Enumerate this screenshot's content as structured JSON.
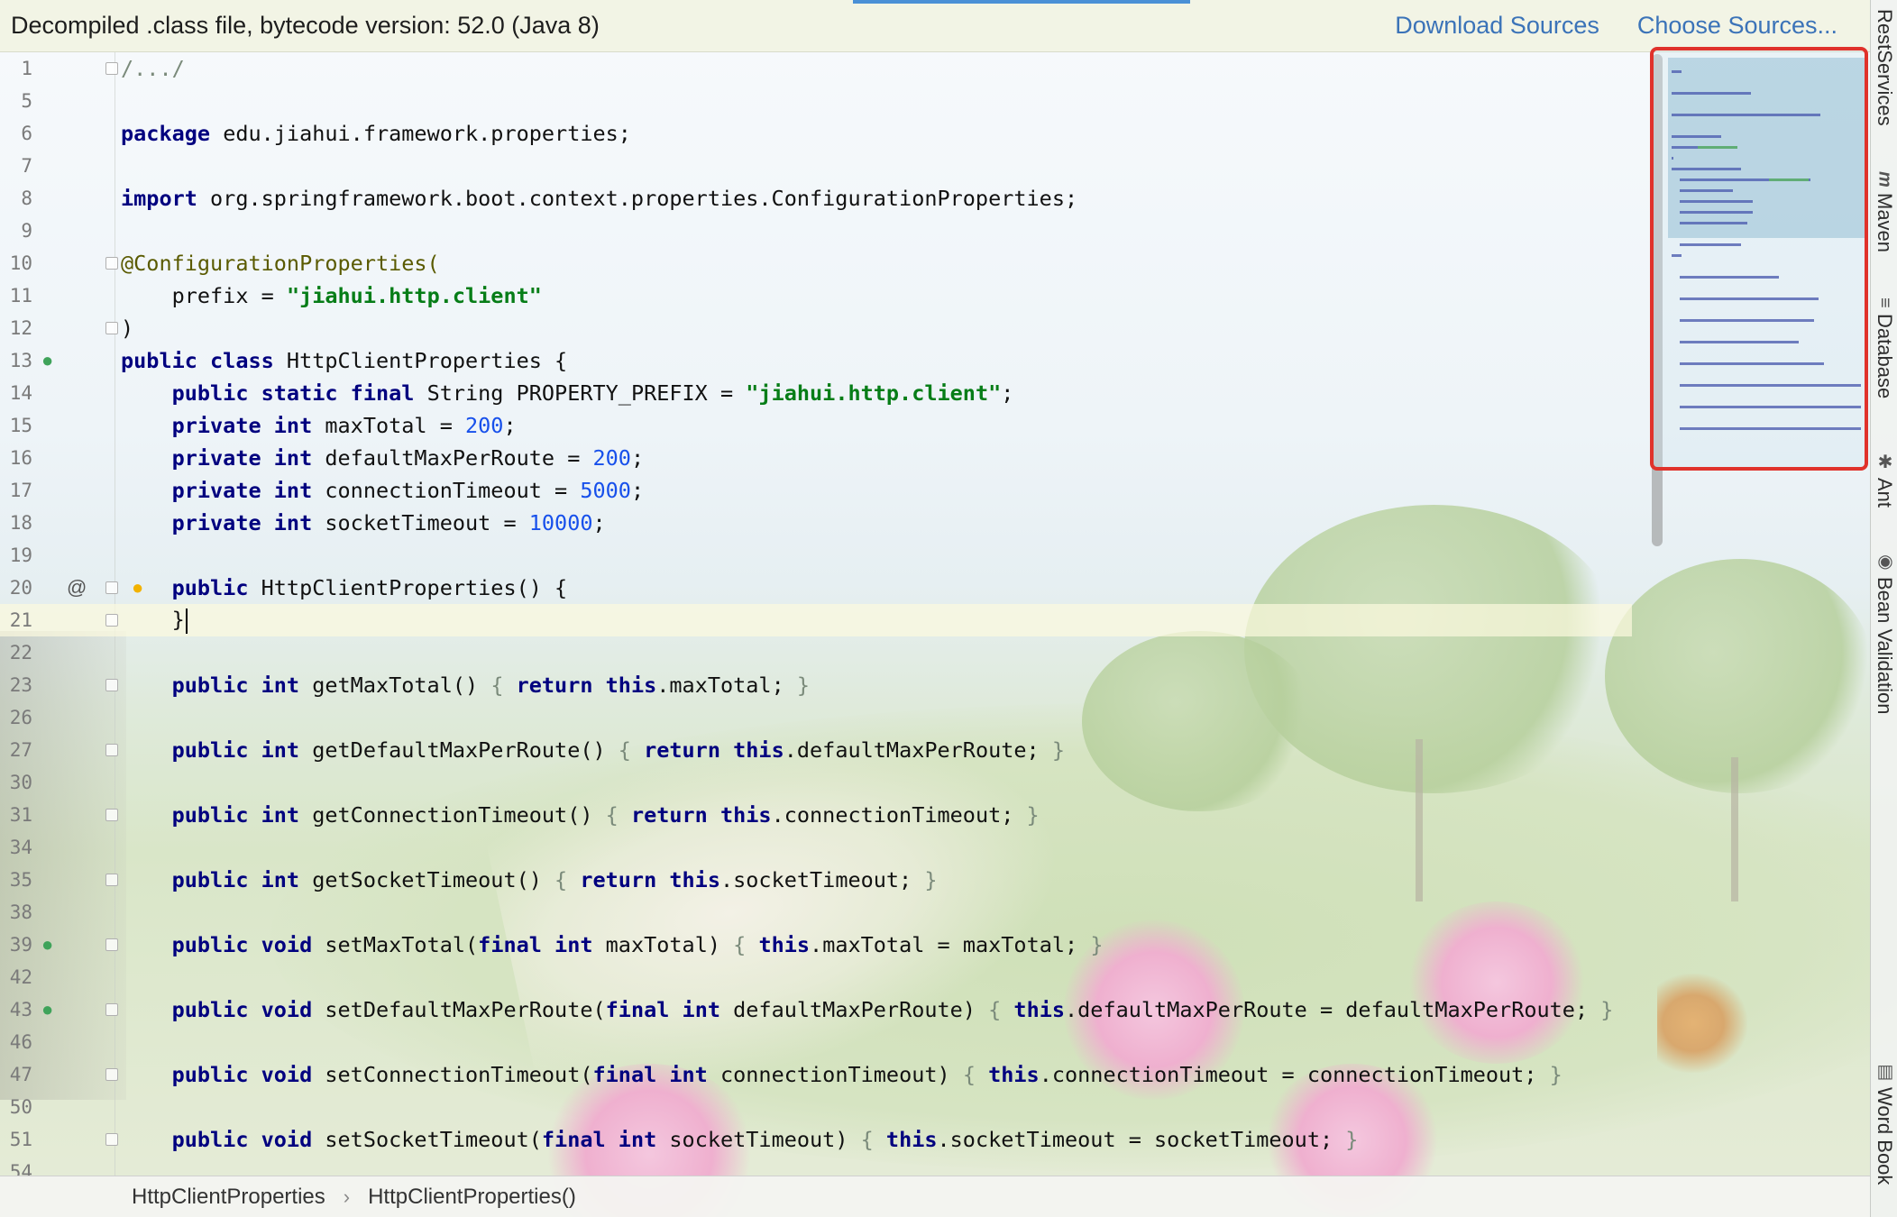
{
  "notification": {
    "message": "Decompiled .class file, bytecode version: 52.0 (Java 8)",
    "download_sources": "Download Sources",
    "choose_sources": "Choose Sources..."
  },
  "editor": {
    "lines": [
      {
        "num": "1",
        "fold": true,
        "tokens": [
          [
            "dim",
            "/.../"
          ]
        ]
      },
      {
        "num": "5",
        "tokens": []
      },
      {
        "num": "6",
        "tokens": [
          [
            "kw",
            "package"
          ],
          [
            "t",
            " edu.jiahui.framework.properties;"
          ]
        ]
      },
      {
        "num": "7",
        "tokens": []
      },
      {
        "num": "8",
        "tokens": [
          [
            "kw",
            "import"
          ],
          [
            "t",
            " org.springframework.boot.context.properties.ConfigurationProperties;"
          ]
        ]
      },
      {
        "num": "9",
        "tokens": []
      },
      {
        "num": "10",
        "fold": true,
        "tokens": [
          [
            "ann",
            "@ConfigurationProperties("
          ]
        ]
      },
      {
        "num": "11",
        "tokens": [
          [
            "t",
            "    prefix = "
          ],
          [
            "str",
            "\"jiahui.http.client\""
          ]
        ]
      },
      {
        "num": "12",
        "fold": true,
        "tokens": [
          [
            "t",
            ")"
          ]
        ]
      },
      {
        "num": "13",
        "icon": "spring-bean-icon",
        "tokens": [
          [
            "kw",
            "public class"
          ],
          [
            "t",
            " HttpClientProperties {"
          ]
        ]
      },
      {
        "num": "14",
        "tokens": [
          [
            "t",
            "    "
          ],
          [
            "kw",
            "public static final"
          ],
          [
            "t",
            " String PROPERTY_PREFIX = "
          ],
          [
            "str",
            "\"jiahui.http.client\""
          ],
          [
            "t",
            ";"
          ]
        ]
      },
      {
        "num": "15",
        "tokens": [
          [
            "t",
            "    "
          ],
          [
            "kw",
            "private int"
          ],
          [
            "t",
            " maxTotal = "
          ],
          [
            "num",
            "200"
          ],
          [
            "t",
            ";"
          ]
        ]
      },
      {
        "num": "16",
        "tokens": [
          [
            "t",
            "    "
          ],
          [
            "kw",
            "private int"
          ],
          [
            "t",
            " defaultMaxPerRoute = "
          ],
          [
            "num",
            "200"
          ],
          [
            "t",
            ";"
          ]
        ]
      },
      {
        "num": "17",
        "tokens": [
          [
            "t",
            "    "
          ],
          [
            "kw",
            "private int"
          ],
          [
            "t",
            " connectionTimeout = "
          ],
          [
            "num",
            "5000"
          ],
          [
            "t",
            ";"
          ]
        ]
      },
      {
        "num": "18",
        "tokens": [
          [
            "t",
            "    "
          ],
          [
            "kw",
            "private int"
          ],
          [
            "t",
            " socketTimeout = "
          ],
          [
            "num",
            "10000"
          ],
          [
            "t",
            ";"
          ]
        ]
      },
      {
        "num": "19",
        "tokens": []
      },
      {
        "num": "20",
        "fold": true,
        "icon": "at-icon",
        "bulb": true,
        "tokens": [
          [
            "t",
            "    "
          ],
          [
            "kw",
            "public"
          ],
          [
            "t",
            " HttpClientProperties() {"
          ]
        ]
      },
      {
        "num": "21",
        "fold": true,
        "current": true,
        "caret": true,
        "tokens": [
          [
            "t",
            "    }"
          ]
        ]
      },
      {
        "num": "22",
        "tokens": []
      },
      {
        "num": "23",
        "fold": true,
        "tokens": [
          [
            "t",
            "    "
          ],
          [
            "kw",
            "public int"
          ],
          [
            "t",
            " getMaxTotal() "
          ],
          [
            "dim",
            "{ "
          ],
          [
            "kw",
            "return this"
          ],
          [
            "t",
            ".maxTotal; "
          ],
          [
            "dim",
            "}"
          ]
        ]
      },
      {
        "num": "26",
        "tokens": []
      },
      {
        "num": "27",
        "fold": true,
        "tokens": [
          [
            "t",
            "    "
          ],
          [
            "kw",
            "public int"
          ],
          [
            "t",
            " getDefaultMaxPerRoute() "
          ],
          [
            "dim",
            "{ "
          ],
          [
            "kw",
            "return this"
          ],
          [
            "t",
            ".defaultMaxPerRoute; "
          ],
          [
            "dim",
            "}"
          ]
        ]
      },
      {
        "num": "30",
        "tokens": []
      },
      {
        "num": "31",
        "fold": true,
        "tokens": [
          [
            "t",
            "    "
          ],
          [
            "kw",
            "public int"
          ],
          [
            "t",
            " getConnectionTimeout() "
          ],
          [
            "dim",
            "{ "
          ],
          [
            "kw",
            "return this"
          ],
          [
            "t",
            ".connectionTimeout; "
          ],
          [
            "dim",
            "}"
          ]
        ]
      },
      {
        "num": "34",
        "tokens": []
      },
      {
        "num": "35",
        "fold": true,
        "tokens": [
          [
            "t",
            "    "
          ],
          [
            "kw",
            "public int"
          ],
          [
            "t",
            " getSocketTimeout() "
          ],
          [
            "dim",
            "{ "
          ],
          [
            "kw",
            "return this"
          ],
          [
            "t",
            ".socketTimeout; "
          ],
          [
            "dim",
            "}"
          ]
        ]
      },
      {
        "num": "38",
        "tokens": []
      },
      {
        "num": "39",
        "fold": true,
        "icon": "spring-setter-icon",
        "tokens": [
          [
            "t",
            "    "
          ],
          [
            "kw",
            "public void"
          ],
          [
            "t",
            " setMaxTotal("
          ],
          [
            "kw",
            "final int"
          ],
          [
            "t",
            " maxTotal) "
          ],
          [
            "dim",
            "{ "
          ],
          [
            "kw",
            "this"
          ],
          [
            "t",
            ".maxTotal = maxTotal; "
          ],
          [
            "dim",
            "}"
          ]
        ]
      },
      {
        "num": "42",
        "tokens": []
      },
      {
        "num": "43",
        "fold": true,
        "icon": "spring-setter-icon",
        "tokens": [
          [
            "t",
            "    "
          ],
          [
            "kw",
            "public void"
          ],
          [
            "t",
            " setDefaultMaxPerRoute("
          ],
          [
            "kw",
            "final int"
          ],
          [
            "t",
            " defaultMaxPerRoute) "
          ],
          [
            "dim",
            "{ "
          ],
          [
            "kw",
            "this"
          ],
          [
            "t",
            ".defaultMaxPerRoute = defaultMaxPerRoute; "
          ],
          [
            "dim",
            "}"
          ]
        ]
      },
      {
        "num": "46",
        "tokens": []
      },
      {
        "num": "47",
        "fold": true,
        "tokens": [
          [
            "t",
            "    "
          ],
          [
            "kw",
            "public void"
          ],
          [
            "t",
            " setConnectionTimeout("
          ],
          [
            "kw",
            "final int"
          ],
          [
            "t",
            " connectionTimeout) "
          ],
          [
            "dim",
            "{ "
          ],
          [
            "kw",
            "this"
          ],
          [
            "t",
            ".connectionTimeout = connectionTimeout; "
          ],
          [
            "dim",
            "}"
          ]
        ]
      },
      {
        "num": "50",
        "tokens": []
      },
      {
        "num": "51",
        "fold": true,
        "tokens": [
          [
            "t",
            "    "
          ],
          [
            "kw",
            "public void"
          ],
          [
            "t",
            " setSocketTimeout("
          ],
          [
            "kw",
            "final int"
          ],
          [
            "t",
            " socketTimeout) "
          ],
          [
            "dim",
            "{ "
          ],
          [
            "kw",
            "this"
          ],
          [
            "t",
            ".socketTimeout = socketTimeout; "
          ],
          [
            "dim",
            "}"
          ]
        ]
      },
      {
        "num": "54",
        "tokens": []
      }
    ]
  },
  "tool_windows": [
    {
      "label": "RestServices",
      "icon": ""
    },
    {
      "label": "Maven",
      "icon": "m"
    },
    {
      "label": "Database",
      "icon": "≡"
    },
    {
      "label": "Ant",
      "icon": "✱"
    },
    {
      "label": "Bean Validation",
      "icon": "◉"
    },
    {
      "label": "Word Book",
      "icon": "▥"
    }
  ],
  "breadcrumb": [
    "HttpClientProperties",
    "HttpClientProperties()"
  ],
  "colors": {
    "keyword": "#00007f",
    "string": "#067d17",
    "number": "#1750eb",
    "link": "#3b73b8",
    "highlight_border": "#e0322b"
  }
}
